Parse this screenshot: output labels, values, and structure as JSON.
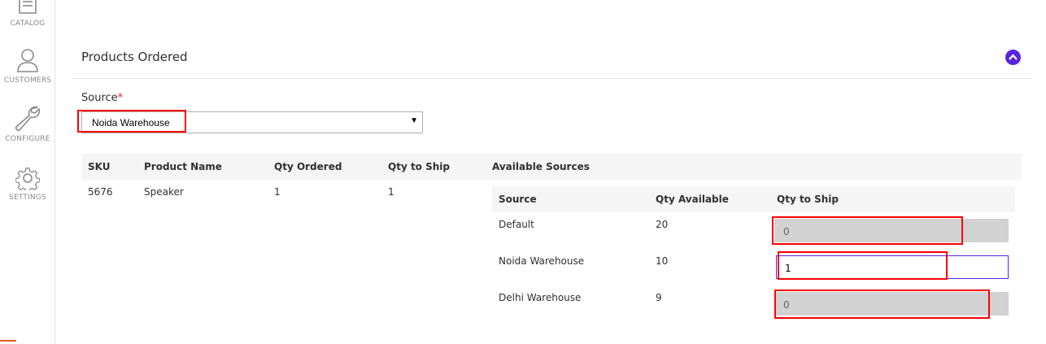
{
  "sidebar": {
    "items": [
      {
        "label": "CATALOG",
        "icon": "catalog-icon"
      },
      {
        "label": "CUSTOMERS",
        "icon": "customer-icon"
      },
      {
        "label": "CONFIGURE",
        "icon": "wrench-icon"
      },
      {
        "label": "SETTINGS",
        "icon": "gear-icon"
      }
    ]
  },
  "section": {
    "title": "Products Ordered",
    "collapse_icon": "chevron-up-icon"
  },
  "source": {
    "label": "Source",
    "required_mark": "*",
    "selected": "Noida Warehouse",
    "arrow": "▼"
  },
  "table": {
    "headers": {
      "sku": "SKU",
      "product_name": "Product Name",
      "qty_ordered": "Qty Ordered",
      "qty_to_ship": "Qty to Ship",
      "available_sources": "Available Sources"
    },
    "row": {
      "sku": "5676",
      "product_name": "Speaker",
      "qty_ordered": "1",
      "qty_to_ship": "1"
    }
  },
  "sources_table": {
    "headers": {
      "source": "Source",
      "qty_available": "Qty Available",
      "qty_to_ship": "Qty to Ship"
    },
    "rows": [
      {
        "source": "Default",
        "qty_available": "20",
        "qty_to_ship": "0"
      },
      {
        "source": "Noida Warehouse",
        "qty_available": "10",
        "qty_to_ship": "1"
      },
      {
        "source": "Delhi Warehouse",
        "qty_available": "9",
        "qty_to_ship": "0"
      }
    ]
  },
  "colors": {
    "accent": "#5b22e0",
    "highlight": "#ff0000"
  }
}
